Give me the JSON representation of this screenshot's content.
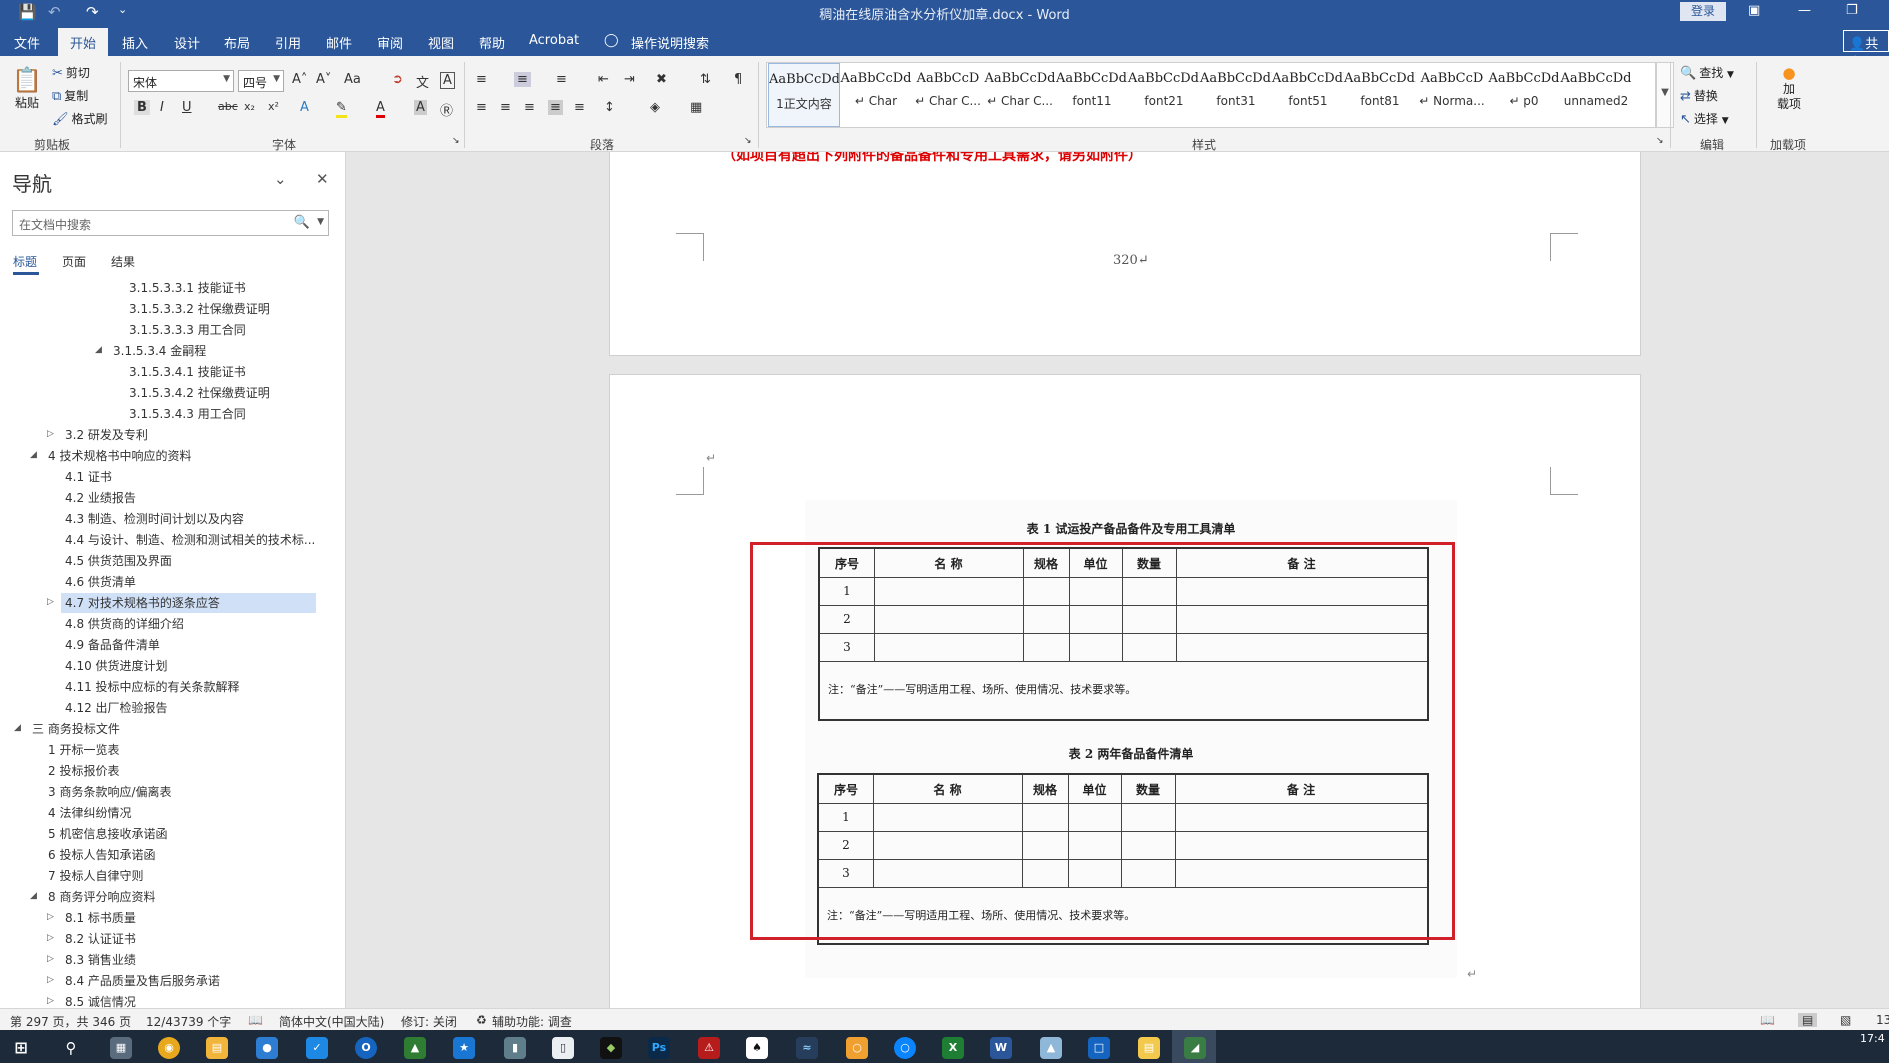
{
  "titlebar": {
    "title": "稠油在线原油含水分析仪加章.docx - Word",
    "login": "登录",
    "icons": [
      "save-icon",
      "undo-icon",
      "redo-icon",
      "customize-icon"
    ]
  },
  "tabs": [
    "文件",
    "开始",
    "插入",
    "设计",
    "布局",
    "引用",
    "邮件",
    "审阅",
    "视图",
    "帮助",
    "Acrobat"
  ],
  "active_tab": "开始",
  "tell_me": "操作说明搜索",
  "share": "共享",
  "ribbon": {
    "clipboard": {
      "paste": "粘贴",
      "cut": "剪切",
      "copy": "复制",
      "format_painter": "格式刷",
      "label": "剪贴板"
    },
    "font": {
      "name": "宋体",
      "size": "四号",
      "label": "字体",
      "aa": "Aa"
    },
    "paragraph": {
      "label": "段落"
    },
    "styles": {
      "label": "样式",
      "items": [
        {
          "sample": "AaBbCcDd",
          "name": "1正文内容"
        },
        {
          "sample": "AaBbCcDd",
          "name": "↵ Char"
        },
        {
          "sample": "AaBbCcD",
          "name": "↵ Char C..."
        },
        {
          "sample": "AaBbCcDd",
          "name": "↵ Char C..."
        },
        {
          "sample": "AaBbCcDdI",
          "name": "font11"
        },
        {
          "sample": "AaBbCcDdE",
          "name": "font21"
        },
        {
          "sample": "AaBbCcDdEe",
          "name": "font31"
        },
        {
          "sample": "AaBbCcDdEe",
          "name": "font51"
        },
        {
          "sample": "AaBbCcDdEe",
          "name": "font81"
        },
        {
          "sample": "AaBbCcD",
          "name": "↵ Norma..."
        },
        {
          "sample": "AaBbCcDd",
          "name": "↵ p0"
        },
        {
          "sample": "AaBbCcDd",
          "name": "unnamed2"
        }
      ]
    },
    "editing": {
      "find": "查找",
      "replace": "替换",
      "select": "选择",
      "label": "编辑"
    },
    "addins": {
      "button": "加\n载项",
      "label": "加载项"
    }
  },
  "nav": {
    "title": "导航",
    "search_placeholder": "在文档中搜索",
    "tabs": [
      "标题",
      "页面",
      "结果"
    ],
    "items": [
      {
        "text": "3.1.5.3.3.1 技能证书",
        "level": 4,
        "tri": ""
      },
      {
        "text": "3.1.5.3.3.2 社保缴费证明",
        "level": 4,
        "tri": ""
      },
      {
        "text": "3.1.5.3.3.3  用工合同",
        "level": 4,
        "tri": ""
      },
      {
        "text": "3.1.5.3.4 金嗣程",
        "level": 3,
        "tri": "down"
      },
      {
        "text": "3.1.5.3.4.1 技能证书",
        "level": 4,
        "tri": ""
      },
      {
        "text": "3.1.5.3.4.2 社保缴费证明",
        "level": 4,
        "tri": ""
      },
      {
        "text": "3.1.5.3.4.3 用工合同",
        "level": 4,
        "tri": ""
      },
      {
        "text": "3.2 研发及专利",
        "level": 2,
        "tri": "right"
      },
      {
        "text": "4 技术规格书中响应的资料",
        "level": 1,
        "tri": "down"
      },
      {
        "text": "4.1 证书",
        "level": 2,
        "tri": ""
      },
      {
        "text": "4.2 业绩报告",
        "level": 2,
        "tri": ""
      },
      {
        "text": "4.3 制造、检测时间计划以及内容",
        "level": 2,
        "tri": ""
      },
      {
        "text": "4.4 与设计、制造、检测和测试相关的技术标...",
        "level": 2,
        "tri": ""
      },
      {
        "text": "4.5 供货范围及界面",
        "level": 2,
        "tri": ""
      },
      {
        "text": "4.6 供货清单",
        "level": 2,
        "tri": ""
      },
      {
        "text": "4.7 对技术规格书的逐条应答",
        "level": 2,
        "tri": "right",
        "selected": true
      },
      {
        "text": "4.8 供货商的详细介绍",
        "level": 2,
        "tri": ""
      },
      {
        "text": "4.9 备品备件清单",
        "level": 2,
        "tri": ""
      },
      {
        "text": "4.10 供货进度计划",
        "level": 2,
        "tri": ""
      },
      {
        "text": "4.11 投标中应标的有关条款解释",
        "level": 2,
        "tri": ""
      },
      {
        "text": "4.12 出厂检验报告",
        "level": 2,
        "tri": ""
      },
      {
        "text": "三 商务投标文件",
        "level": 0,
        "tri": "down"
      },
      {
        "text": "1 开标一览表",
        "level": 1,
        "tri": ""
      },
      {
        "text": "2 投标报价表",
        "level": 1,
        "tri": ""
      },
      {
        "text": "3 商务条款响应/偏离表",
        "level": 1,
        "tri": ""
      },
      {
        "text": "4 法律纠纷情况",
        "level": 1,
        "tri": ""
      },
      {
        "text": "5 机密信息接收承诺函",
        "level": 1,
        "tri": ""
      },
      {
        "text": "6 投标人告知承诺函",
        "level": 1,
        "tri": ""
      },
      {
        "text": "7 投标人自律守则",
        "level": 1,
        "tri": ""
      },
      {
        "text": "8 商务评分响应资料",
        "level": 1,
        "tri": "down"
      },
      {
        "text": "8.1 标书质量",
        "level": 2,
        "tri": "right"
      },
      {
        "text": "8.2 认证证书",
        "level": 2,
        "tri": "right"
      },
      {
        "text": "8.3 销售业绩",
        "level": 2,
        "tri": "right"
      },
      {
        "text": "8.4 产品质量及售后服务承诺",
        "level": 2,
        "tri": "right"
      },
      {
        "text": "8.5 诚信情况",
        "level": 2,
        "tri": "right"
      }
    ]
  },
  "document": {
    "red_heading": "（如项目有超出下列附件的备品备件和专用工具需求，请另如附件）",
    "page_number": "320↵",
    "para_mark": "↵",
    "table1": {
      "caption": "表 1   试运投产备品备件及专用工具清单",
      "headers": [
        "序号",
        "名  称",
        "规格",
        "单位",
        "数量",
        "备    注"
      ],
      "rows": [
        "1",
        "2",
        "3"
      ],
      "note": "注：“备注”——写明适用工程、场所、使用情况、技术要求等。"
    },
    "table2": {
      "caption": "表 2   两年备品备件清单",
      "headers": [
        "序号",
        "名  称",
        "规格",
        "单位",
        "数量",
        "备    注"
      ],
      "rows": [
        "1",
        "2",
        "3"
      ],
      "note": "注：“备注”——写明适用工程、场所、使用情况、技术要求等。"
    },
    "highlight_color": "#d0202a"
  },
  "statusbar": {
    "page": "第 297 页，共 346 页",
    "words": "12/43739 个字",
    "language": "简体中文(中国大陆)",
    "track": "修订: 关闭",
    "accessibility": "辅助功能: 调查",
    "zoom": "13"
  },
  "taskbar": {
    "time": "17:4"
  },
  "colors": {
    "word_blue": "#2b579a",
    "red": "#d00"
  }
}
